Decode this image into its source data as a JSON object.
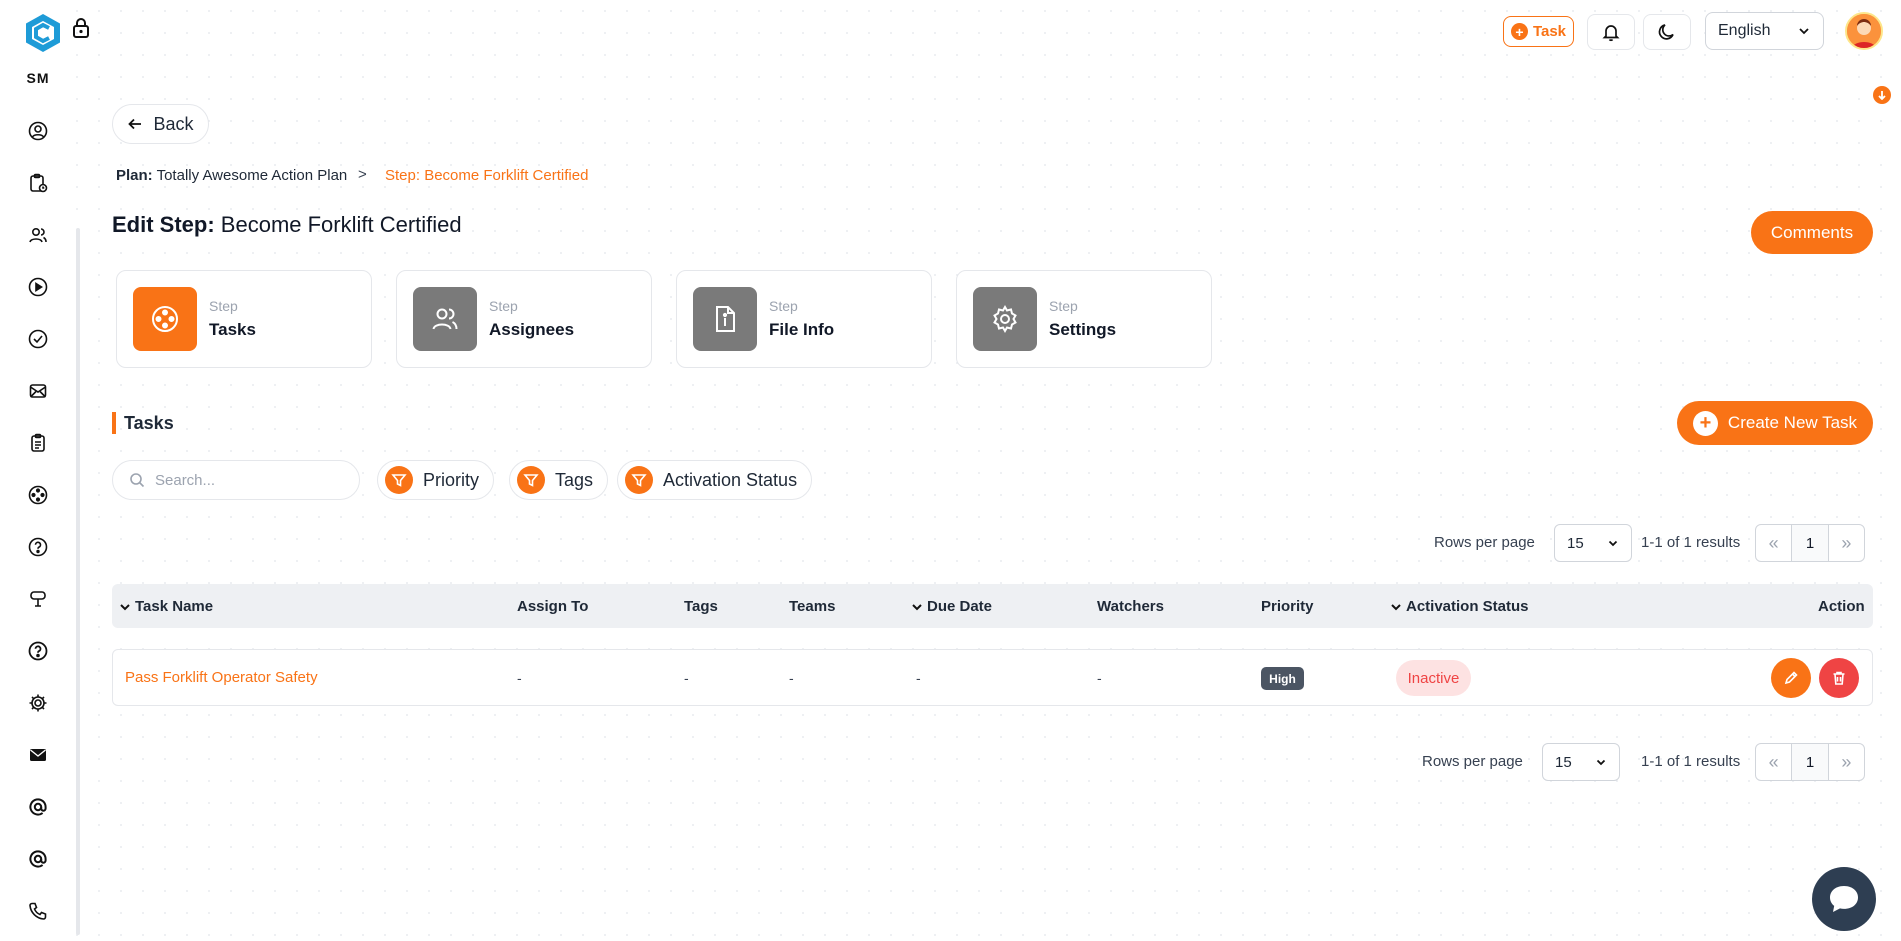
{
  "app": {
    "brand": "SM",
    "accent_color": "#f97316"
  },
  "header": {
    "task_label": "Task",
    "language": "English",
    "icons": [
      "bell-icon",
      "moon-icon",
      "chevron-down-icon"
    ]
  },
  "sidebar": {
    "items": [
      {
        "icon": "user-circle-icon"
      },
      {
        "icon": "clipboard-clock-icon"
      },
      {
        "icon": "users-icon"
      },
      {
        "icon": "play-circle-icon"
      },
      {
        "icon": "check-circle-icon"
      },
      {
        "icon": "mail-open-icon"
      },
      {
        "icon": "clipboard-list-icon"
      },
      {
        "icon": "target-dots-icon"
      },
      {
        "icon": "help-circle-icon"
      },
      {
        "icon": "cup-icon"
      },
      {
        "icon": "question-circle-icon"
      },
      {
        "icon": "gear-icon"
      },
      {
        "icon": "envelope-icon"
      },
      {
        "icon": "at-sign-icon"
      },
      {
        "icon": "at-sign-icon"
      },
      {
        "icon": "phone-icon"
      }
    ]
  },
  "page": {
    "back_label": "Back",
    "breadcrumb": {
      "plan_prefix": "Plan:",
      "plan_name": "Totally Awesome Action Plan",
      "separator": ">",
      "current": "Step: Become Forklift Certified"
    },
    "title_prefix": "Edit Step:",
    "title_name": "Become Forklift Certified",
    "comments_label": "Comments"
  },
  "step_tabs": [
    {
      "sub": "Step",
      "name": "Tasks",
      "icon": "target-dots-icon",
      "active": true
    },
    {
      "sub": "Step",
      "name": "Assignees",
      "icon": "users-icon",
      "active": false
    },
    {
      "sub": "Step",
      "name": "File Info",
      "icon": "file-info-icon",
      "active": false
    },
    {
      "sub": "Step",
      "name": "Settings",
      "icon": "gear-icon",
      "active": false
    }
  ],
  "tasks_section": {
    "title": "Tasks",
    "create_label": "Create New Task",
    "search_placeholder": "Search...",
    "filters": [
      "Priority",
      "Tags",
      "Activation Status"
    ]
  },
  "pagination": {
    "rows_label": "Rows per page",
    "rows_value": "15",
    "results": "1-1 of 1 results",
    "page": "1"
  },
  "table": {
    "columns": [
      "Task Name",
      "Assign To",
      "Tags",
      "Teams",
      "Due Date",
      "Watchers",
      "Priority",
      "Activation Status",
      "Action"
    ],
    "rows": [
      {
        "task_name": "Pass Forklift Operator Safety",
        "assign_to": "-",
        "tags": "-",
        "teams": "-",
        "due_date": "-",
        "watchers": "-",
        "priority": "High",
        "activation_status": "Inactive"
      }
    ]
  }
}
